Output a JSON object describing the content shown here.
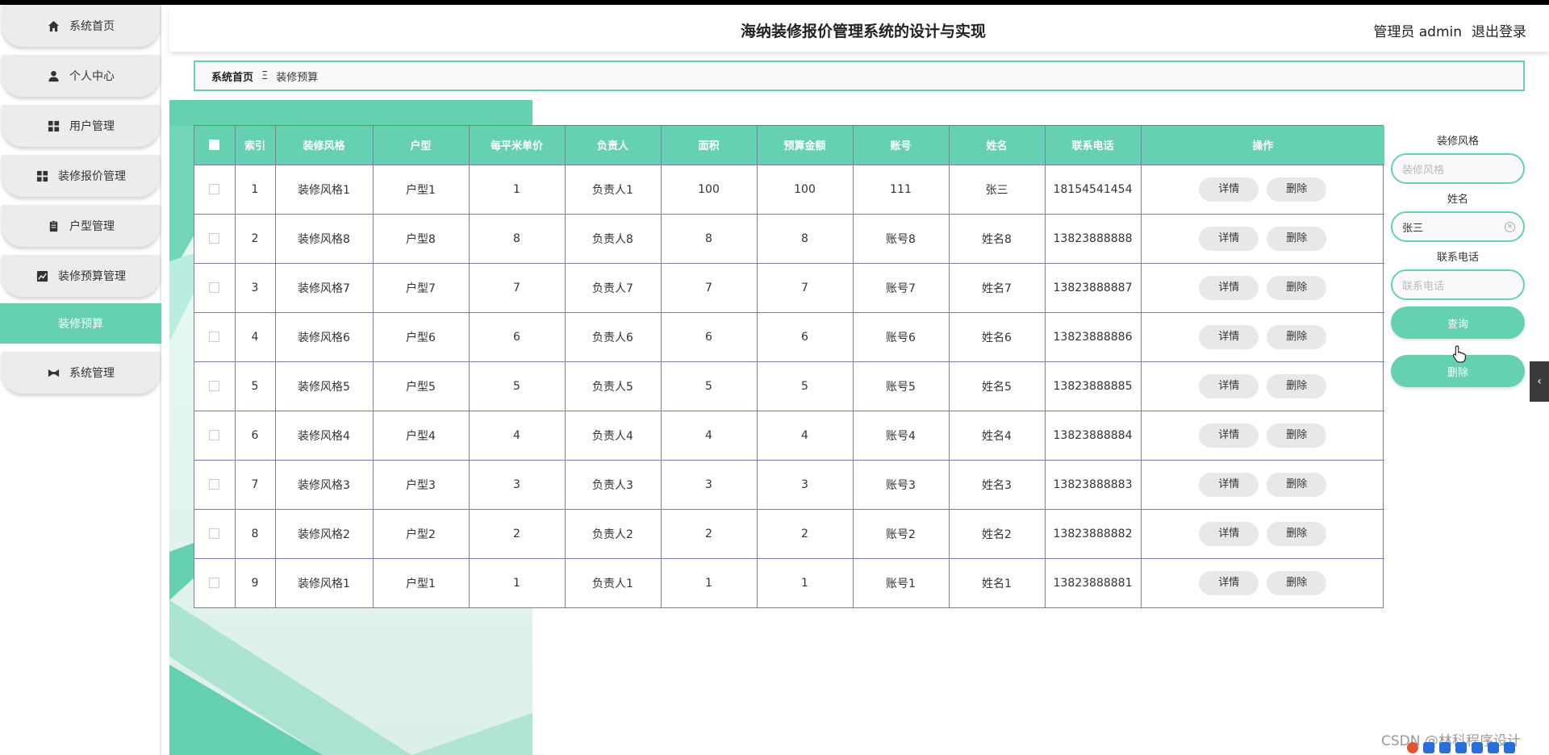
{
  "header": {
    "title": "海纳装修报价管理系统的设计与实现",
    "user_label": "管理员 admin",
    "logout_label": "退出登录"
  },
  "sidebar": {
    "items": [
      {
        "label": "系统首页",
        "icon": "home-icon"
      },
      {
        "label": "个人中心",
        "icon": "person-icon"
      },
      {
        "label": "用户管理",
        "icon": "grid-icon"
      },
      {
        "label": "装修报价管理",
        "icon": "grid-icon"
      },
      {
        "label": "户型管理",
        "icon": "clipboard-icon"
      },
      {
        "label": "装修预算管理",
        "icon": "chart-icon"
      }
    ],
    "submenu_label": "装修预算",
    "last_item": {
      "label": "系统管理",
      "icon": "bowtie-icon"
    }
  },
  "breadcrumb": {
    "home": "系统首页",
    "separator": "Ξ",
    "current": "装修预算"
  },
  "table": {
    "headers": [
      "索引",
      "装修风格",
      "户型",
      "每平米单价",
      "负责人",
      "面积",
      "预算金额",
      "账号",
      "姓名",
      "联系电话",
      "操作"
    ],
    "detail_label": "详情",
    "delete_label": "删除",
    "rows": [
      [
        "1",
        "装修风格1",
        "户型1",
        "1",
        "负责人1",
        "100",
        "100",
        "111",
        "张三",
        "18154541454"
      ],
      [
        "2",
        "装修风格8",
        "户型8",
        "8",
        "负责人8",
        "8",
        "8",
        "账号8",
        "姓名8",
        "13823888888"
      ],
      [
        "3",
        "装修风格7",
        "户型7",
        "7",
        "负责人7",
        "7",
        "7",
        "账号7",
        "姓名7",
        "13823888887"
      ],
      [
        "4",
        "装修风格6",
        "户型6",
        "6",
        "负责人6",
        "6",
        "6",
        "账号6",
        "姓名6",
        "13823888886"
      ],
      [
        "5",
        "装修风格5",
        "户型5",
        "5",
        "负责人5",
        "5",
        "5",
        "账号5",
        "姓名5",
        "13823888885"
      ],
      [
        "6",
        "装修风格4",
        "户型4",
        "4",
        "负责人4",
        "4",
        "4",
        "账号4",
        "姓名4",
        "13823888884"
      ],
      [
        "7",
        "装修风格3",
        "户型3",
        "3",
        "负责人3",
        "3",
        "3",
        "账号3",
        "姓名3",
        "13823888883"
      ],
      [
        "8",
        "装修风格2",
        "户型2",
        "2",
        "负责人2",
        "2",
        "2",
        "账号2",
        "姓名2",
        "13823888882"
      ],
      [
        "9",
        "装修风格1",
        "户型1",
        "1",
        "负责人1",
        "1",
        "1",
        "账号1",
        "姓名1",
        "13823888881"
      ]
    ]
  },
  "search": {
    "style_label": "装修风格",
    "style_placeholder": "装修风格",
    "name_label": "姓名",
    "name_value": "张三",
    "phone_label": "联系电话",
    "phone_placeholder": "联系电话",
    "query_button": "查询",
    "delete_button": "删除"
  },
  "watermark": "CSDN @林科程序设计",
  "colors": {
    "accent": "#66d1b1",
    "table_border": "#7b7fa3",
    "pill_bg": "#e8e8e8"
  }
}
